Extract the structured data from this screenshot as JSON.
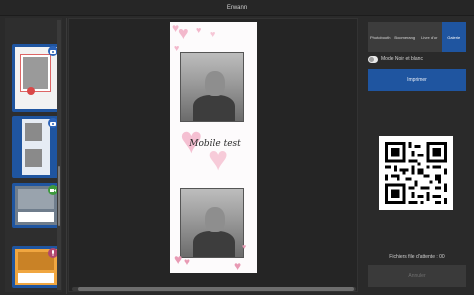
{
  "window": {
    "title": "Erwann"
  },
  "rail": {
    "cards": [
      {
        "name": "template-card-1",
        "badge_color": "#2c63b8",
        "badge_icon": "camera-icon",
        "caption": ""
      },
      {
        "name": "template-card-2",
        "badge_color": "#2c63b8",
        "badge_icon": "camera-icon",
        "caption": ""
      },
      {
        "name": "template-card-3",
        "badge_color": "#3d9a3d",
        "badge_icon": "video-camera-icon",
        "caption": ""
      },
      {
        "name": "template-card-4",
        "badge_color": "#b0476f",
        "badge_icon": "microphone-icon",
        "caption": ""
      }
    ]
  },
  "preview": {
    "caption": "Mobile test"
  },
  "tabs": [
    {
      "label": "Photobooth",
      "active": false
    },
    {
      "label": "Boomerang",
      "active": false
    },
    {
      "label": "Livre d'or",
      "active": false
    },
    {
      "label": "Galerie",
      "active": true
    }
  ],
  "options": {
    "noir_blanc_label": "Mode Noir et blanc"
  },
  "actions": {
    "print_label": "Imprimer",
    "cancel_label": "Annuler"
  },
  "queue": {
    "label": "Fichiers file d'attente : 00"
  },
  "colors": {
    "accent": "#1f55a0",
    "panel": "#2a2a2a"
  }
}
